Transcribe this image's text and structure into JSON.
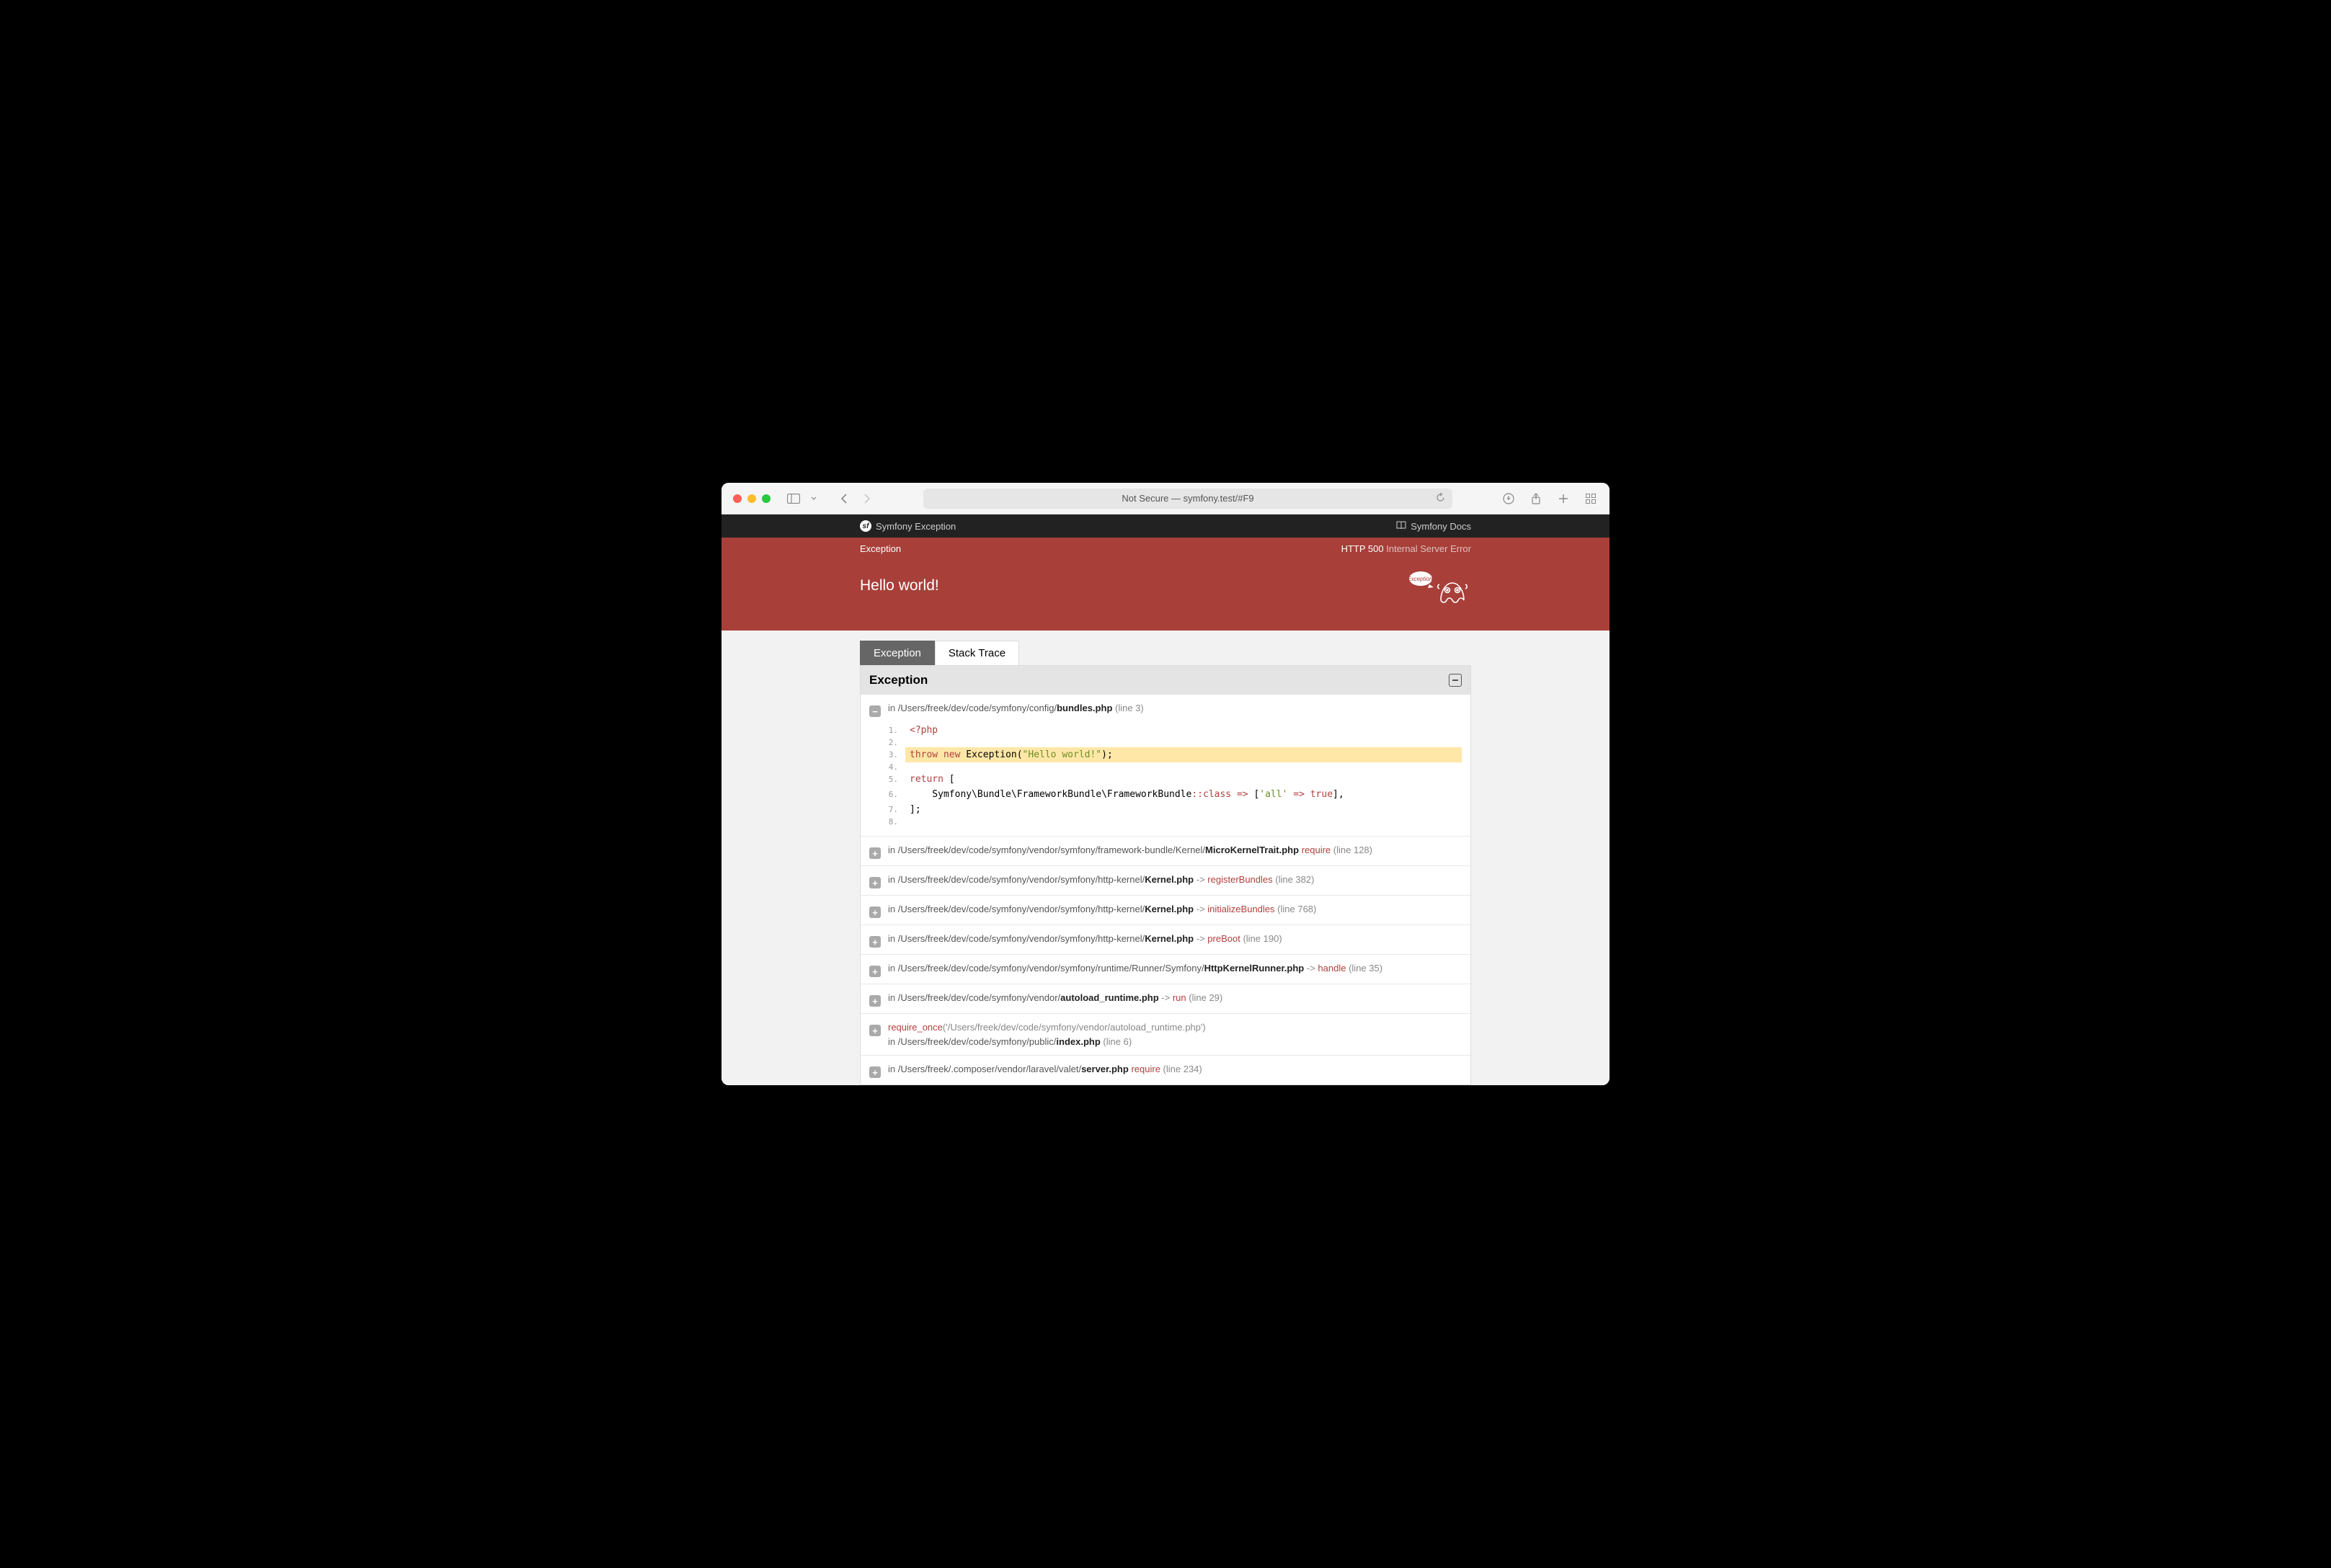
{
  "browser": {
    "address": "Not Secure — symfony.test/#F9"
  },
  "topbar": {
    "left": "Symfony Exception",
    "right": "Symfony Docs"
  },
  "banner": {
    "exception_class": "Exception",
    "http_label": "HTTP 500",
    "http_desc": "Internal Server Error",
    "title": "Hello world!"
  },
  "tabs": {
    "exception": "Exception",
    "stack_trace": "Stack Trace"
  },
  "panel": {
    "heading": "Exception"
  },
  "frames": [
    {
      "expanded": true,
      "in": "in",
      "path": "/Users/freek/dev/code/symfony/config/",
      "file": "bundles.php",
      "line_label": "(line 3)",
      "code": [
        {
          "n": "1",
          "hl": false,
          "html": "<span class='tok-kw'>&lt;?php</span>"
        },
        {
          "n": "2",
          "hl": false,
          "html": ""
        },
        {
          "n": "3",
          "hl": true,
          "html": "<span class='tok-kw'>throw</span> <span class='tok-kw'>new</span> Exception(<span class='tok-str'>\"Hello world!\"</span>);"
        },
        {
          "n": "4",
          "hl": false,
          "html": ""
        },
        {
          "n": "5",
          "hl": false,
          "html": "<span class='tok-kw'>return</span> ["
        },
        {
          "n": "6",
          "hl": false,
          "html": "    Symfony\\Bundle\\FrameworkBundle\\FrameworkBundle<span class='tok-sym'>::</span><span class='tok-kw'>class</span> <span class='tok-sym'>=&gt;</span> [<span class='tok-str'>'all'</span> <span class='tok-sym'>=&gt;</span> <span class='tok-kw'>true</span>],"
        },
        {
          "n": "7",
          "hl": false,
          "html": "];"
        },
        {
          "n": "8",
          "hl": false,
          "html": ""
        }
      ]
    },
    {
      "expanded": false,
      "in": "in",
      "path": "/Users/freek/dev/code/symfony/vendor/symfony/framework-bundle/Kernel/",
      "file": "MicroKernelTrait.php",
      "arrow": " ",
      "call": "require",
      "line_label": "(line 128)"
    },
    {
      "expanded": false,
      "in": "in",
      "path": "/Users/freek/dev/code/symfony/vendor/symfony/http-kernel/",
      "file": "Kernel.php",
      "arrow": "->",
      "call": "registerBundles",
      "line_label": "(line 382)"
    },
    {
      "expanded": false,
      "in": "in",
      "path": "/Users/freek/dev/code/symfony/vendor/symfony/http-kernel/",
      "file": "Kernel.php",
      "arrow": "->",
      "call": "initializeBundles",
      "line_label": "(line 768)"
    },
    {
      "expanded": false,
      "in": "in",
      "path": "/Users/freek/dev/code/symfony/vendor/symfony/http-kernel/",
      "file": "Kernel.php",
      "arrow": "->",
      "call": "preBoot",
      "line_label": "(line 190)"
    },
    {
      "expanded": false,
      "in": "in",
      "path": "/Users/freek/dev/code/symfony/vendor/symfony/runtime/Runner/Symfony/",
      "file": "HttpKernelRunner.php",
      "arrow": "->",
      "call": "handle",
      "line_label": "(line 35)"
    },
    {
      "expanded": false,
      "in": "in",
      "path": "/Users/freek/dev/code/symfony/vendor/",
      "file": "autoload_runtime.php",
      "arrow": "->",
      "call": "run",
      "line_label": "(line 29)"
    },
    {
      "expanded": false,
      "special": true,
      "top_call": "require_once",
      "top_arg": "('/Users/freek/dev/code/symfony/vendor/autoload_runtime.php')",
      "in": "in",
      "path": "/Users/freek/dev/code/symfony/public/",
      "file": "index.php",
      "line_label": "(line 6)"
    },
    {
      "expanded": false,
      "in": "in",
      "path": "/Users/freek/.composer/vendor/laravel/valet/",
      "file": "server.php",
      "arrow": " ",
      "call": "require",
      "line_label": "(line 234)"
    }
  ]
}
